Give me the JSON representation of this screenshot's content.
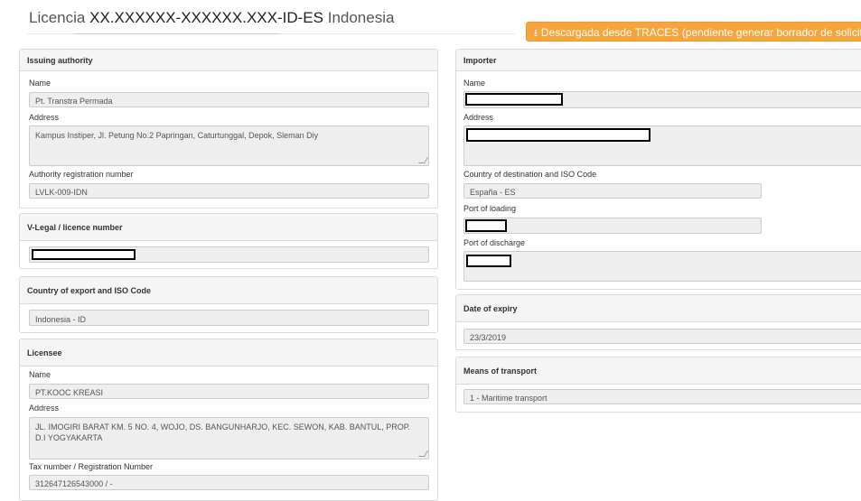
{
  "header": {
    "title_prefix": "Licencia",
    "title_code": "XX.XXXXXX-XXXXXX.XXX-ID-ES",
    "title_suffix": "Indonesia",
    "download_label": "Descargada desde TRACES (pendiente generar borrador de solicitud)",
    "download_icon": "download-icon"
  },
  "issuing_authority": {
    "heading": "Issuing authority",
    "name_label": "Name",
    "name_value": "Pt. Transtra Permada",
    "address_label": "Address",
    "address_value": "Kampus Instiper, Jl. Petung No.2 Papringan, Caturtunggal, Depok, Sleman Diy",
    "reg_label": "Authority registration number",
    "reg_value": "LVLK-009-IDN"
  },
  "vlegal": {
    "heading": "V-Legal / licence number"
  },
  "country_export": {
    "heading": "Country of export and ISO Code",
    "value": "Indonesia - ID"
  },
  "licensee": {
    "heading": "Licensee",
    "name_label": "Name",
    "name_value": "PT.KOOC KREASI",
    "address_label": "Address",
    "address_value": "JL. IMOGIRI BARAT KM. 5 NO. 4, WOJO, DS. BANGUNHARJO, KEC. SEWON,  KAB. BANTUL, PROP. D.I YOGYAKARTA",
    "tax_label": "Tax number / Registration Number",
    "tax_value": "312647126543000 / -"
  },
  "importer": {
    "heading": "Importer",
    "name_label": "Name",
    "address_label": "Address",
    "country_label": "Country of destination and ISO Code",
    "country_value": "España - ES",
    "loading_label": "Port of loading",
    "discharge_label": "Port of discharge"
  },
  "expiry": {
    "heading": "Date of expiry",
    "value": "23/3/2019"
  },
  "transport": {
    "heading": "Means of transport",
    "value": "1 - Maritime transport"
  }
}
